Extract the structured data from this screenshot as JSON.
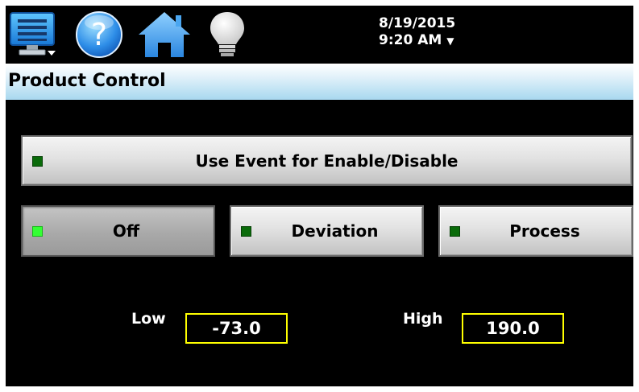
{
  "toolbar": {
    "icons": [
      "menu-icon",
      "help-icon",
      "home-icon",
      "lightbulb-icon"
    ],
    "date": "8/19/2015",
    "time": "9:20 AM",
    "caret": "▼"
  },
  "title": "Product Control",
  "buttons": {
    "event": {
      "label": "Use Event for Enable/Disable",
      "led": "off"
    },
    "off": {
      "label": "Off",
      "led": "on",
      "selected": true
    },
    "deviation": {
      "label": "Deviation",
      "led": "off"
    },
    "process": {
      "label": "Process",
      "led": "off"
    }
  },
  "limits": {
    "low_label": "Low",
    "low_value": "-73.0",
    "high_label": "High",
    "high_value": "190.0"
  },
  "colors": {
    "background": "#000000",
    "led_on": "#33ff33",
    "led_off": "#0a6b0a",
    "value_border": "#ffff00",
    "titlebar": "#a8d8ef"
  }
}
